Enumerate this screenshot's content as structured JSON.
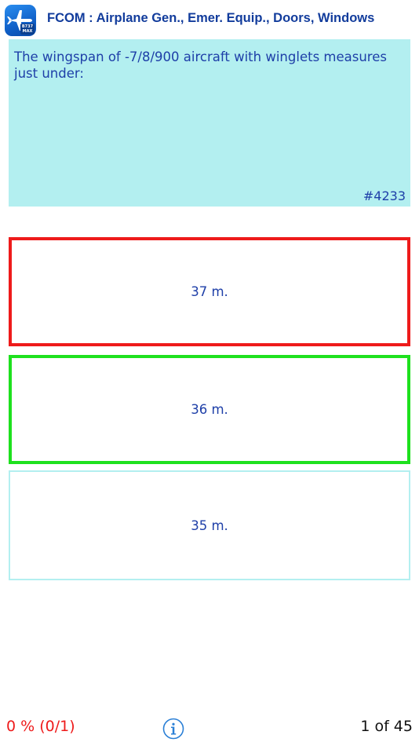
{
  "header": {
    "title": "FCOM : Airplane Gen., Emer. Equip., Doors, Windows",
    "app_icon": "airplane-icon",
    "app_icon_badge": "B737\nMAX"
  },
  "question": {
    "text": "The wingspan of -7/8/900 aircraft with winglets measures just under:",
    "id": "#4233"
  },
  "answers": [
    {
      "label": "37 m.",
      "state": "incorrect"
    },
    {
      "label": "36 m.",
      "state": "correct"
    },
    {
      "label": "35 m.",
      "state": "neutral"
    }
  ],
  "footer": {
    "score": "0 % (0/1)",
    "info_icon": "info-icon",
    "page_indicator": "1 of 45"
  },
  "colors": {
    "accent": "#123c9c",
    "question_bg": "#b3eff0",
    "incorrect": "#ee1b1b",
    "correct": "#1ee11e",
    "neutral_border": "#b3eff0",
    "info_icon": "#2a7fd6"
  }
}
